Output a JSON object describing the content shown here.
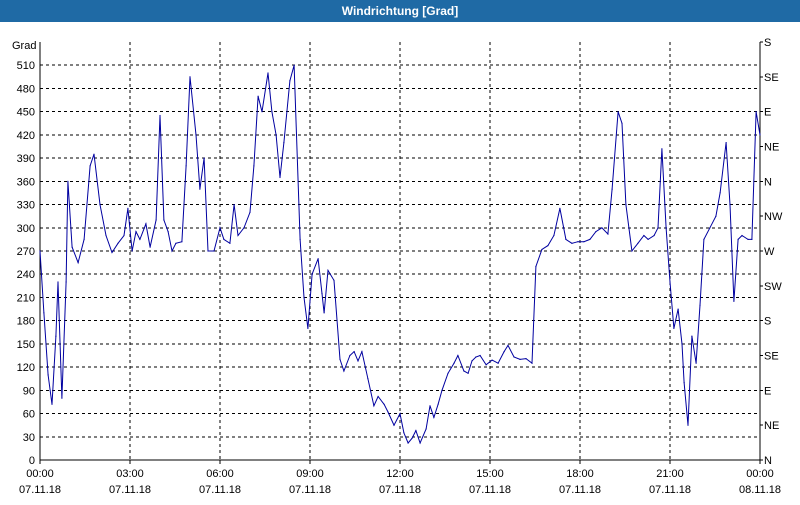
{
  "window": {
    "title": "Windrichtung [Grad]"
  },
  "colors": {
    "title_bar": "#1f6aa5",
    "series": "#0000a0",
    "grid": "#000000"
  },
  "chart_data": {
    "type": "line",
    "title": "Windrichtung [Grad]",
    "ylabel": "Grad",
    "ylim": [
      0,
      540
    ],
    "yticks": [
      0,
      30,
      60,
      90,
      120,
      150,
      180,
      210,
      240,
      270,
      300,
      330,
      360,
      390,
      420,
      450,
      480,
      510
    ],
    "right_ticks": [
      {
        "value": 0,
        "label": "N"
      },
      {
        "value": 45,
        "label": "NE"
      },
      {
        "value": 90,
        "label": "E"
      },
      {
        "value": 135,
        "label": "SE"
      },
      {
        "value": 180,
        "label": "S"
      },
      {
        "value": 225,
        "label": "SW"
      },
      {
        "value": 270,
        "label": "W"
      },
      {
        "value": 315,
        "label": "NW"
      },
      {
        "value": 360,
        "label": "N"
      },
      {
        "value": 405,
        "label": "NE"
      },
      {
        "value": 450,
        "label": "E"
      },
      {
        "value": 495,
        "label": "SE"
      },
      {
        "value": 540,
        "label": "S"
      }
    ],
    "xlim": [
      0,
      24
    ],
    "xticks": [
      {
        "hours": 0,
        "time": "00:00",
        "date": "07.11.18"
      },
      {
        "hours": 3,
        "time": "03:00",
        "date": "07.11.18"
      },
      {
        "hours": 6,
        "time": "06:00",
        "date": "07.11.18"
      },
      {
        "hours": 9,
        "time": "09:00",
        "date": "07.11.18"
      },
      {
        "hours": 12,
        "time": "12:00",
        "date": "07.11.18"
      },
      {
        "hours": 15,
        "time": "15:00",
        "date": "07.11.18"
      },
      {
        "hours": 18,
        "time": "18:00",
        "date": "07.11.18"
      },
      {
        "hours": 21,
        "time": "21:00",
        "date": "07.11.18"
      },
      {
        "hours": 24,
        "time": "00:00",
        "date": "08.11.18"
      }
    ],
    "grid": true,
    "series": [
      {
        "points": [
          [
            0.0,
            270
          ],
          [
            0.13,
            190
          ],
          [
            0.27,
            110
          ],
          [
            0.4,
            72
          ],
          [
            0.53,
            160
          ],
          [
            0.6,
            230
          ],
          [
            0.73,
            80
          ],
          [
            0.87,
            230
          ],
          [
            0.93,
            360
          ],
          [
            1.07,
            275
          ],
          [
            1.27,
            255
          ],
          [
            1.47,
            285
          ],
          [
            1.67,
            380
          ],
          [
            1.8,
            395
          ],
          [
            2.0,
            330
          ],
          [
            2.2,
            290
          ],
          [
            2.4,
            268
          ],
          [
            2.6,
            280
          ],
          [
            2.8,
            290
          ],
          [
            2.93,
            325
          ],
          [
            3.07,
            270
          ],
          [
            3.2,
            295
          ],
          [
            3.33,
            285
          ],
          [
            3.53,
            305
          ],
          [
            3.67,
            275
          ],
          [
            3.87,
            310
          ],
          [
            4.0,
            445
          ],
          [
            4.13,
            310
          ],
          [
            4.27,
            295
          ],
          [
            4.4,
            270
          ],
          [
            4.53,
            280
          ],
          [
            4.73,
            282
          ],
          [
            4.87,
            380
          ],
          [
            5.0,
            495
          ],
          [
            5.2,
            420
          ],
          [
            5.33,
            350
          ],
          [
            5.47,
            390
          ],
          [
            5.6,
            270
          ],
          [
            5.8,
            270
          ],
          [
            6.0,
            300
          ],
          [
            6.13,
            285
          ],
          [
            6.33,
            280
          ],
          [
            6.47,
            330
          ],
          [
            6.6,
            290
          ],
          [
            6.8,
            300
          ],
          [
            7.0,
            320
          ],
          [
            7.13,
            380
          ],
          [
            7.27,
            470
          ],
          [
            7.4,
            450
          ],
          [
            7.6,
            500
          ],
          [
            7.73,
            450
          ],
          [
            7.87,
            420
          ],
          [
            8.0,
            365
          ],
          [
            8.13,
            410
          ],
          [
            8.33,
            490
          ],
          [
            8.47,
            510
          ],
          [
            8.67,
            285
          ],
          [
            8.8,
            210
          ],
          [
            8.93,
            170
          ],
          [
            9.07,
            240
          ],
          [
            9.27,
            260
          ],
          [
            9.4,
            215
          ],
          [
            9.47,
            190
          ],
          [
            9.6,
            245
          ],
          [
            9.8,
            232
          ],
          [
            10.0,
            130
          ],
          [
            10.13,
            115
          ],
          [
            10.33,
            135
          ],
          [
            10.47,
            140
          ],
          [
            10.6,
            128
          ],
          [
            10.73,
            140
          ],
          [
            10.93,
            105
          ],
          [
            11.13,
            70
          ],
          [
            11.27,
            82
          ],
          [
            11.47,
            72
          ],
          [
            11.6,
            62
          ],
          [
            11.8,
            45
          ],
          [
            12.0,
            60
          ],
          [
            12.13,
            35
          ],
          [
            12.27,
            22
          ],
          [
            12.4,
            28
          ],
          [
            12.53,
            38
          ],
          [
            12.67,
            22
          ],
          [
            12.87,
            40
          ],
          [
            13.0,
            70
          ],
          [
            13.13,
            55
          ],
          [
            13.27,
            72
          ],
          [
            13.4,
            90
          ],
          [
            13.6,
            112
          ],
          [
            13.8,
            125
          ],
          [
            13.93,
            135
          ],
          [
            14.13,
            115
          ],
          [
            14.27,
            112
          ],
          [
            14.4,
            128
          ],
          [
            14.53,
            133
          ],
          [
            14.67,
            135
          ],
          [
            14.87,
            123
          ],
          [
            15.07,
            129
          ],
          [
            15.27,
            125
          ],
          [
            15.47,
            140
          ],
          [
            15.6,
            148
          ],
          [
            15.8,
            133
          ],
          [
            16.0,
            130
          ],
          [
            16.2,
            131
          ],
          [
            16.4,
            125
          ],
          [
            16.53,
            250
          ],
          [
            16.73,
            272
          ],
          [
            16.93,
            277
          ],
          [
            17.13,
            290
          ],
          [
            17.33,
            325
          ],
          [
            17.53,
            285
          ],
          [
            17.73,
            280
          ],
          [
            17.93,
            282
          ],
          [
            18.13,
            282
          ],
          [
            18.33,
            285
          ],
          [
            18.53,
            295
          ],
          [
            18.73,
            300
          ],
          [
            18.93,
            292
          ],
          [
            19.07,
            350
          ],
          [
            19.27,
            450
          ],
          [
            19.4,
            435
          ],
          [
            19.53,
            330
          ],
          [
            19.73,
            270
          ],
          [
            19.93,
            280
          ],
          [
            20.13,
            290
          ],
          [
            20.27,
            285
          ],
          [
            20.47,
            290
          ],
          [
            20.6,
            300
          ],
          [
            20.73,
            402
          ],
          [
            20.87,
            300
          ],
          [
            21.0,
            230
          ],
          [
            21.13,
            170
          ],
          [
            21.27,
            195
          ],
          [
            21.4,
            150
          ],
          [
            21.47,
            100
          ],
          [
            21.6,
            45
          ],
          [
            21.73,
            160
          ],
          [
            21.87,
            125
          ],
          [
            22.0,
            200
          ],
          [
            22.13,
            285
          ],
          [
            22.33,
            300
          ],
          [
            22.53,
            315
          ],
          [
            22.67,
            345
          ],
          [
            22.87,
            410
          ],
          [
            23.0,
            330
          ],
          [
            23.13,
            205
          ],
          [
            23.27,
            285
          ],
          [
            23.4,
            290
          ],
          [
            23.6,
            285
          ],
          [
            23.73,
            285
          ],
          [
            23.87,
            450
          ],
          [
            24.0,
            420
          ]
        ]
      }
    ]
  }
}
